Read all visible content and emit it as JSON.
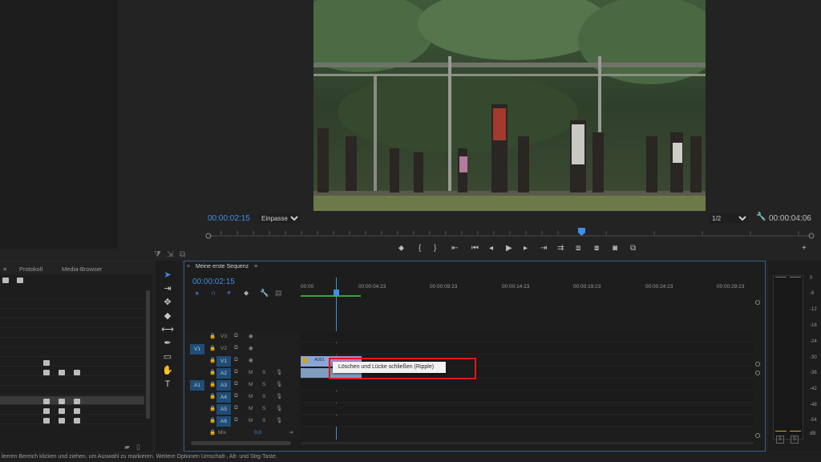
{
  "program_monitor": {
    "current_timecode": "00:00:02:15",
    "fit_option": "Einpassen",
    "resolution_option": "1/2",
    "duration_timecode": "00:00:04:06"
  },
  "project_panel": {
    "tabs": [
      "Protokoll",
      "Media-Browser"
    ]
  },
  "timeline": {
    "sequence_name": "Meine erste Sequenz",
    "current_timecode": "00:00:02:15",
    "ruler_ticks": [
      "00:00",
      "00:00:04:23",
      "00:00:09:23",
      "00:00:14:23",
      "00:00:19:23",
      "00:00:24:23",
      "00:00:29:23"
    ],
    "video_tracks": [
      "V3",
      "V2",
      "V1"
    ],
    "audio_tracks": [
      "A2",
      "A3",
      "A4",
      "A5",
      "A6"
    ],
    "source_video": "V1",
    "source_audio": "A1",
    "mix_label": "Mix",
    "mix_value": "0,0",
    "clip_label": "A001",
    "track_letters": {
      "m": "M",
      "s": "S"
    }
  },
  "context_menu": {
    "item": "Löschen und Lücke schließen (Ripple)"
  },
  "meters": {
    "db_labels": [
      "0",
      "-6",
      "-12",
      "-18",
      "-24",
      "-30",
      "-36",
      "-42",
      "-48",
      "-54",
      "dB"
    ],
    "solo_buttons": [
      "S",
      "S"
    ]
  },
  "status_bar": {
    "text": "leeren Bereich klicken und ziehen, um Auswahl zu markieren. Weitere Optionen Umschalt-, Alt- und Strg-Taste."
  },
  "colors": {
    "accent_blue": "#3d8ee8",
    "highlight_red": "#e01818",
    "panel_bg": "#1d1d1d",
    "frame_bg": "#232323"
  }
}
